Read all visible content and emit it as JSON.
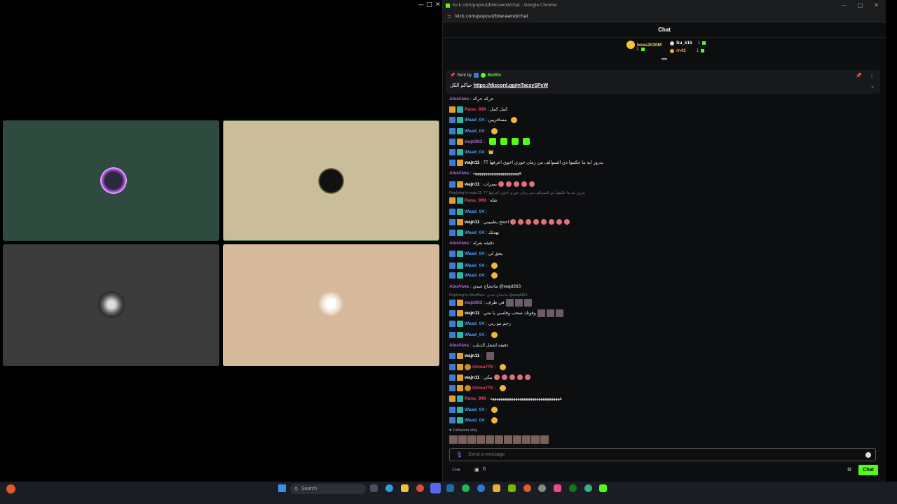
{
  "browser": {
    "title": "kick.com/popout/blwrawnd/chat - Google Chrome",
    "url": "kick.com/popout/blwrawnd/chat",
    "left_window_controls": [
      "—",
      "□",
      "✕"
    ],
    "right_window_controls": [
      "—",
      "□",
      "✕"
    ]
  },
  "chat": {
    "header": "Chat",
    "top_gifters": [
      {
        "name": "boss2030M",
        "count": "1",
        "color": "#f5d64a"
      },
      {
        "name": "Su_k15",
        "count": "1",
        "color": "#ffffff"
      },
      {
        "name": "rn42",
        "count": "1",
        "color": "#f5a34a"
      }
    ],
    "pinned": {
      "sent_by_label": "Sent by",
      "bot": "BotRix",
      "text_prefix": "حياكم الكل",
      "link": "https://discord.gg/mTacsySPcW"
    },
    "messages": [
      {
        "user": "AboAlwa",
        "color": "#b06ad8",
        "text": ": حركه حركه"
      },
      {
        "user": "Rana_999",
        "color": "#e04a5a",
        "text": ": كمل كمل"
      },
      {
        "user": "Waad_04",
        "color": "#4a9ff5",
        "text": ": مسافريين"
      },
      {
        "user": "Waad_04",
        "color": "#4a9ff5",
        "text": ":"
      },
      {
        "user": "wajd363",
        "color": "#b06ad8",
        "text": ":"
      },
      {
        "user": "Waad_04",
        "color": "#4a9ff5",
        "text": ": 👑"
      },
      {
        "user": "wajn11",
        "color": "#ffffff",
        "text": ": يدرور ايه ما حكيتوا ذي السوالف من زمان خوري اخوي اعرفها ؟؟"
      },
      {
        "user": "AboAlwa",
        "color": "#b06ad8",
        "text": ": ههههههههههههههههههههههه"
      },
      {
        "user": "wajn11",
        "color": "#ffffff",
        "text": ": يميرات"
      },
      {
        "user": "Rana_999",
        "color": "#e04a5a",
        "text": ": نقله"
      },
      {
        "user": "Waad_04",
        "color": "#4a9ff5",
        "text": ":"
      },
      {
        "user": "wajn11",
        "color": "#ffffff",
        "text": ": اخحح يطيييبي"
      },
      {
        "user": "Waad_04",
        "color": "#4a9ff5",
        "text": ": يهدئك"
      },
      {
        "user": "AboAlwa",
        "color": "#b06ad8",
        "text": ": دقيقه بفرله"
      },
      {
        "user": "Waad_04",
        "color": "#4a9ff5",
        "text": ": يحق لي"
      },
      {
        "user": "Waad_04",
        "color": "#4a9ff5",
        "text": ":"
      },
      {
        "user": "Waad_04",
        "color": "#4a9ff5",
        "text": ":"
      },
      {
        "user": "AboAlwa",
        "color": "#b06ad8",
        "text": ": ماحجاج عندي @wajd363"
      },
      {
        "user": "wajd363",
        "color": "#b06ad8",
        "text": ": في ظرف"
      },
      {
        "user": "wajn11",
        "color": "#ffffff",
        "text": ": وقوتك صحب وفلسي يا بنتي"
      },
      {
        "user": "Waad_04",
        "color": "#4a9ff5",
        "text": ": رحم مو ربي"
      },
      {
        "user": "Waad_04",
        "color": "#4a9ff5",
        "text": ":"
      },
      {
        "user": "AboAlwa",
        "color": "#b06ad8",
        "text": ": دقيقه اشغل الديلب"
      },
      {
        "user": "wajn11",
        "color": "#ffffff",
        "text": ":"
      },
      {
        "user": "Ghina778",
        "color": "#e04a5a",
        "text": ":"
      },
      {
        "user": "wajn11",
        "color": "#ffffff",
        "text": ": بيكي"
      },
      {
        "user": "Ghina778",
        "color": "#e04a5a",
        "text": ":"
      },
      {
        "user": "Rana_999",
        "color": "#e04a5a",
        "text": ": هههههههههههههههههههههههههههههههههه"
      },
      {
        "user": "Waad_04",
        "color": "#4a9ff5",
        "text": ":"
      },
      {
        "user": "Waad_04",
        "color": "#4a9ff5",
        "text": ":"
      }
    ],
    "replies": [
      {
        "text": "Replying to wajn11: يدرور ايه ما حكيتوا ذي السوالف من زمان خوري اخوي اعرفها ؟؟"
      },
      {
        "text": "Replying to AboAlwa: ماحجاج عندي @wajd363"
      }
    ],
    "followers_only": "Followers only",
    "input_placeholder": "Send a message",
    "viewer_count": "0",
    "send_label": "Chat"
  },
  "taskbar": {
    "search_label": "Search"
  },
  "colors": {
    "kick_green": "#53fc18",
    "tile_1": "#2f4a3f",
    "tile_2": "#c9bd9a",
    "tile_3": "#3b3b3b",
    "tile_4": "#d6b89b"
  }
}
